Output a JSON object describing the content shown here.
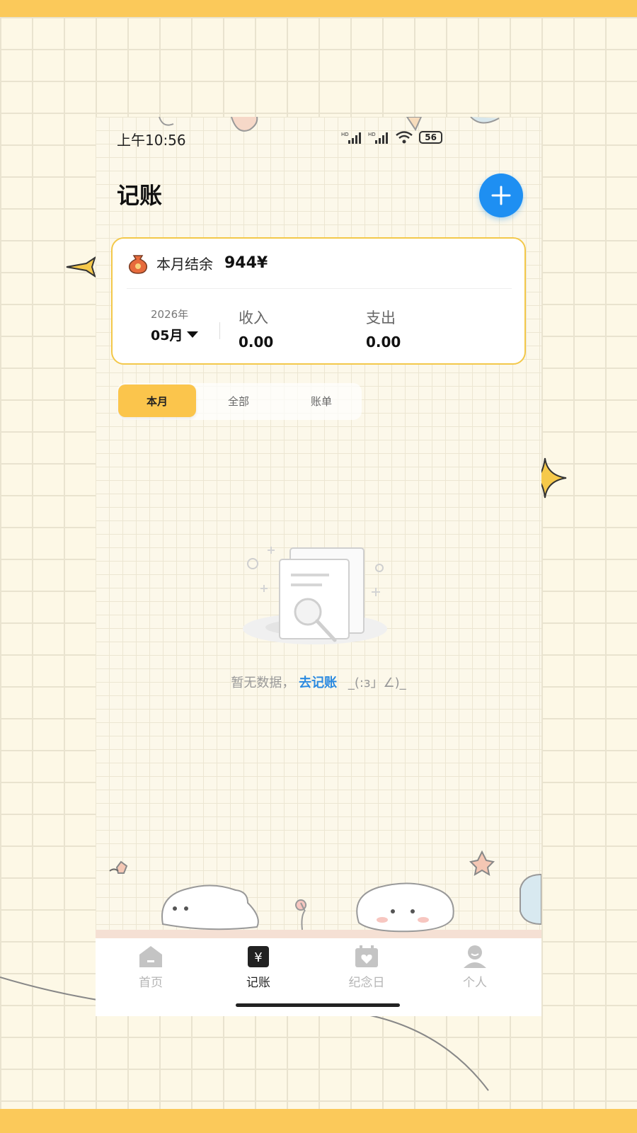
{
  "status_bar": {
    "time": "上午10:56",
    "battery": "56",
    "signal1_label": "HD",
    "signal2_label": "HD"
  },
  "header": {
    "title": "记账",
    "add_icon": "plus-icon",
    "accent_color": "#1e8ff2"
  },
  "summary": {
    "icon": "money-bag-icon",
    "label": "本月结余",
    "balance": "944¥",
    "year": "2026年",
    "month": "05月",
    "income_label": "收入",
    "income_value": "0.00",
    "expense_label": "支出",
    "expense_value": "0.00"
  },
  "tabs": [
    {
      "label": "本月",
      "active": true
    },
    {
      "label": "全部",
      "active": false
    },
    {
      "label": "账单",
      "active": false
    }
  ],
  "empty_state": {
    "message": "暂无数据，",
    "link": "去记账",
    "emoticon": "_(:з」∠)_"
  },
  "nav": [
    {
      "label": "首页",
      "icon": "home-icon",
      "active": false
    },
    {
      "label": "记账",
      "icon": "ledger-icon",
      "active": true
    },
    {
      "label": "纪念日",
      "icon": "calendar-heart-icon",
      "active": false
    },
    {
      "label": "个人",
      "icon": "user-icon",
      "active": false
    }
  ],
  "colors": {
    "highlight": "#fbc54c",
    "card_border": "#f3c84a",
    "link": "#2b8ae0"
  }
}
